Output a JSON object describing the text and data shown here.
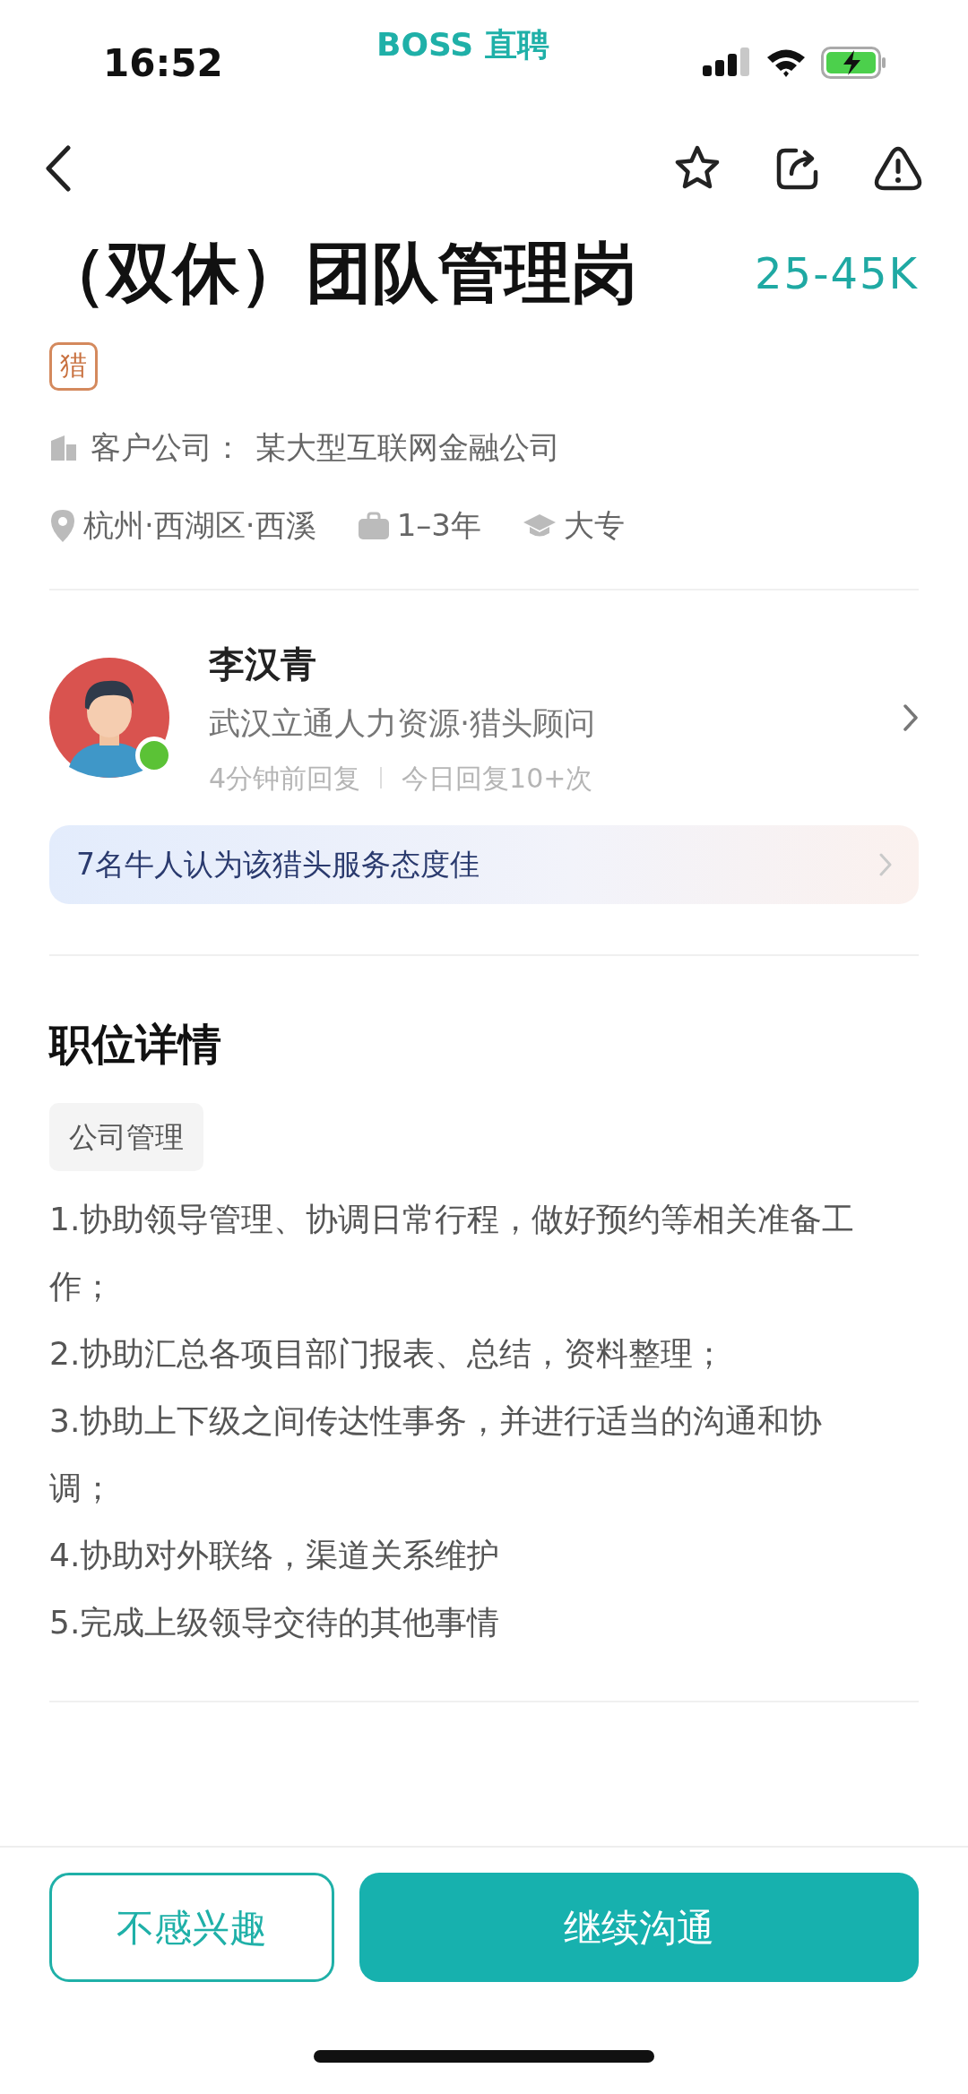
{
  "status_bar": {
    "time": "16:52",
    "app_name": "BOSS 直聘"
  },
  "job": {
    "title": "（双休）团队管理岗",
    "salary": "25-45K",
    "badge": "猎",
    "client_label": "客户公司：",
    "client_company": "某大型互联网金融公司",
    "location": "杭州·西湖区·西溪",
    "experience": "1–3年",
    "education": "大专"
  },
  "recruiter": {
    "name": "李汉青",
    "company_title": "武汉立通人力资源·猎头顾问",
    "last_reply": "4分钟前回复",
    "reply_count": "今日回复10+次",
    "online": true,
    "endorsement": "7名牛人认为该猎头服务态度佳"
  },
  "details": {
    "heading": "职位详情",
    "tags": [
      "公司管理"
    ],
    "lines": [
      "1.协助领导管理、协调日常行程，做好预约等相关准备工作；",
      "2.协助汇总各项目部门报表、总结，资料整理；",
      "3.协助上下级之间传达性事务，并进行适当的沟通和协调；",
      "4.协助对外联络，渠道关系维护",
      "5.完成上级领导交待的其他事情"
    ]
  },
  "actions": [
    {
      "label": "不感兴趣",
      "kind": "outline"
    },
    {
      "label": "继续沟通",
      "kind": "primary"
    }
  ]
}
